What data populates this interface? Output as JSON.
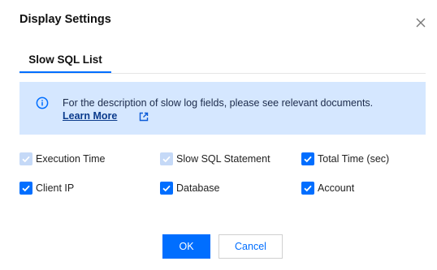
{
  "dialog": {
    "title": "Display Settings",
    "close_icon": "close-icon"
  },
  "tabs": [
    {
      "label": "Slow SQL List",
      "active": true
    }
  ],
  "notice": {
    "icon": "info-icon",
    "text": "For the description of slow log fields, please see relevant documents.",
    "link_label": "Learn More",
    "link_icon": "external-link-icon"
  },
  "options": [
    {
      "label": "Execution Time",
      "checked": true,
      "disabled": true
    },
    {
      "label": "Slow SQL Statement",
      "checked": true,
      "disabled": true
    },
    {
      "label": "Total Time (sec)",
      "checked": true,
      "disabled": false
    },
    {
      "label": "Client IP",
      "checked": true,
      "disabled": false
    },
    {
      "label": "Database",
      "checked": true,
      "disabled": false
    },
    {
      "label": "Account",
      "checked": true,
      "disabled": false
    }
  ],
  "buttons": {
    "ok_label": "OK",
    "cancel_label": "Cancel"
  },
  "colors": {
    "primary": "#006eff",
    "notice_bg": "#d5e7ff",
    "disabled_check": "#c5d9f7"
  }
}
